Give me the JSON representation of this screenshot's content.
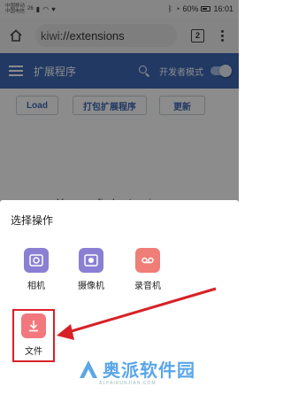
{
  "status_bar": {
    "carrier_line1": "中国移动",
    "carrier_line2": "中国电信",
    "network": "26",
    "battery": "60%",
    "time": "16:01"
  },
  "address_bar": {
    "url_scheme": "kiwi:",
    "url_path": "//extensions",
    "tab_count": "2"
  },
  "ext_toolbar": {
    "title": "扩展程序",
    "dev_mode_label": "开发者模式",
    "dev_mode_on": true
  },
  "buttons": {
    "load": "Load",
    "pack": "打包扩展程序",
    "update": "更新"
  },
  "page": {
    "partial_text": "You can find extensions on"
  },
  "sheet": {
    "title": "选择操作",
    "options": [
      {
        "label": "相机",
        "icon": "camera-icon",
        "color": "#8a7fd3"
      },
      {
        "label": "摄像机",
        "icon": "video-camera-icon",
        "color": "#8a7fd3"
      },
      {
        "label": "录音机",
        "icon": "recorder-icon",
        "color": "#ef7d78"
      },
      {
        "label": "文件",
        "icon": "file-download-icon",
        "color": "#f2787e"
      }
    ]
  },
  "watermark": {
    "brand": "奥派软件园",
    "domain": "ALPAIRUNJIAN.COM"
  },
  "colors": {
    "accent": "#3d68b5",
    "highlight": "#d82127"
  }
}
